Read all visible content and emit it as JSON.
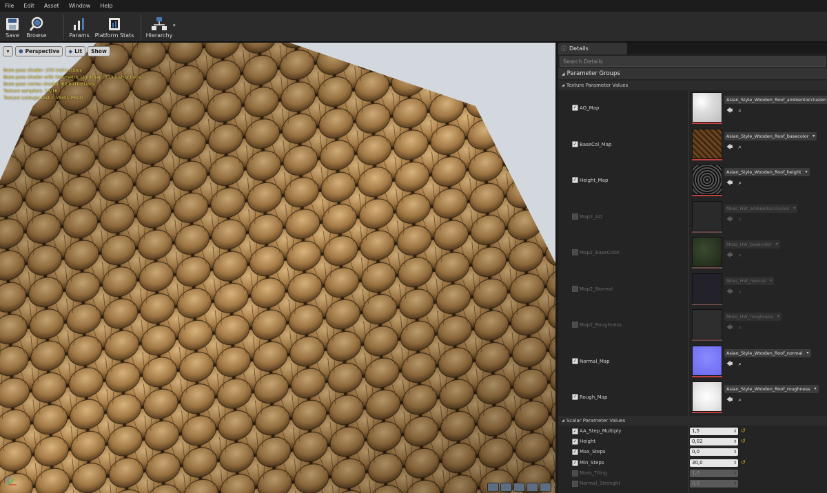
{
  "menu": [
    "File",
    "Edit",
    "Asset",
    "Window",
    "Help"
  ],
  "toolbar": {
    "save": "Save",
    "browse": "Browse",
    "params": "Params",
    "platform_stats": "Platform Stats",
    "hierarchy": "Hierarchy"
  },
  "viewport": {
    "perspective": "Perspective",
    "lit": "Lit",
    "show": "Show",
    "stats": [
      "Base pass shader: 233 instructions",
      "Base pass shader with Volumetric Lightmap: 313 instructions",
      "Base pass vertex shader: 62 instructions",
      "Texture samplers: 13/16",
      "Texture Lookups (Est.): VS(0), PS(9)"
    ]
  },
  "details": {
    "tab": "Details",
    "search_placeholder": "Search Details",
    "group_header": "Parameter Groups",
    "texture_header": "Texture Parameter Values",
    "scalar_header": "Scalar Parameter Values",
    "textures": [
      {
        "name": "AO_Map",
        "asset": "Asian_Style_Wooden_Roof_ambientocclusion",
        "enabled": true,
        "thumb": "ao"
      },
      {
        "name": "BaseCol_Map",
        "asset": "Asian_Style_Wooden_Roof_basecolor",
        "enabled": true,
        "thumb": "base"
      },
      {
        "name": "Height_Map",
        "asset": "Asian_Style_Wooden_Roof_height",
        "enabled": true,
        "thumb": "height"
      },
      {
        "name": "Map2_AO",
        "asset": "Moss_HW_ambientocclusion",
        "enabled": false,
        "thumb": "dark"
      },
      {
        "name": "Map2_BaseColor",
        "asset": "Moss_HW_basecolor",
        "enabled": false,
        "thumb": "moss"
      },
      {
        "name": "Map2_Normal",
        "asset": "Moss_HW_normal",
        "enabled": false,
        "thumb": "darknormal"
      },
      {
        "name": "Map2_Roughness",
        "asset": "Moss_HW_roughness",
        "enabled": false,
        "thumb": "darkgray"
      },
      {
        "name": "Normal_Map",
        "asset": "Asian_Style_Wooden_Roof_normal",
        "enabled": true,
        "thumb": "normal"
      },
      {
        "name": "Rough_Map",
        "asset": "Asian_Style_Wooden_Roof_roughness",
        "enabled": true,
        "thumb": "rough"
      }
    ],
    "scalars": [
      {
        "name": "AA_Step_Multiply",
        "value": "1,5",
        "enabled": true,
        "reset": true
      },
      {
        "name": "Height",
        "value": "0,02",
        "enabled": true,
        "reset": true
      },
      {
        "name": "Max_Steps",
        "value": "0,0",
        "enabled": true,
        "reset": false
      },
      {
        "name": "Min_Steps",
        "value": "30,0",
        "enabled": true,
        "reset": true
      },
      {
        "name": "Moss_Tiling",
        "value": "1,0",
        "enabled": false,
        "reset": false
      },
      {
        "name": "Normal_Strenght",
        "value": "0,0",
        "enabled": false,
        "reset": false
      }
    ]
  }
}
